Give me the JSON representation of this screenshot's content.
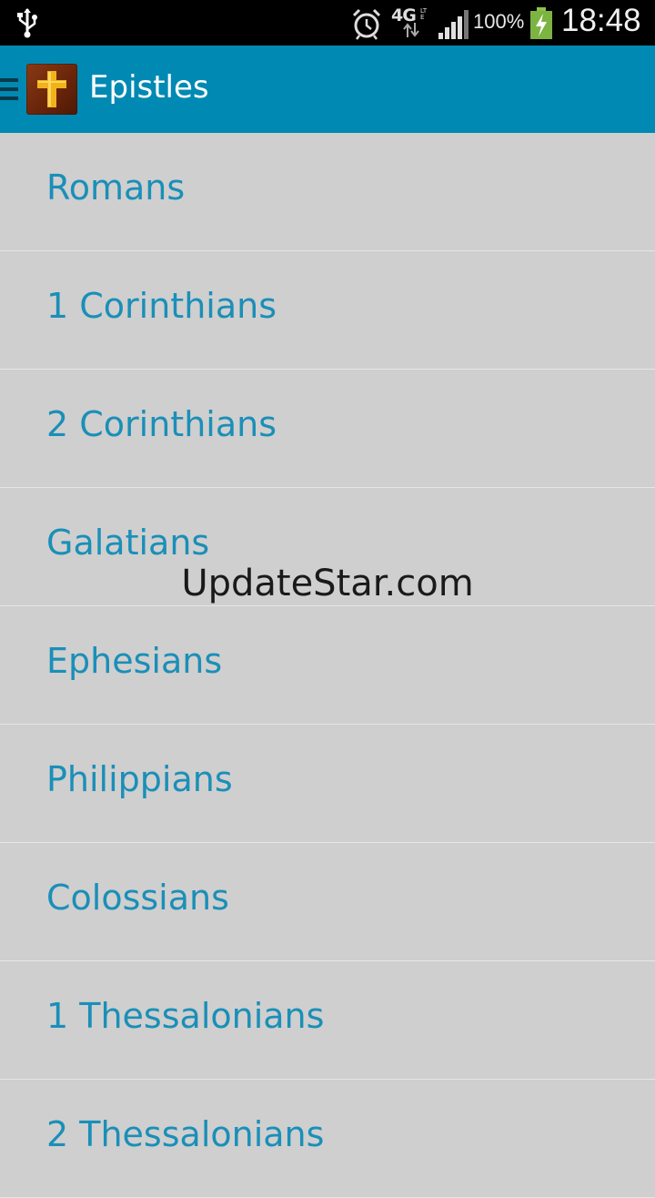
{
  "status_bar": {
    "network_label": "4G",
    "network_sub": "LTE",
    "battery_percent": "100%",
    "time": "18:48",
    "icons": [
      "usb-icon",
      "alarm-icon",
      "network-4g-lte-icon",
      "signal-icon",
      "battery-charging-icon"
    ]
  },
  "action_bar": {
    "title": "Epistles",
    "icons": [
      "drawer-menu-icon",
      "cross-app-icon"
    ],
    "background": "#0089b3"
  },
  "books": [
    {
      "label": "Romans"
    },
    {
      "label": "1 Corinthians"
    },
    {
      "label": "2 Corinthians"
    },
    {
      "label": "Galatians"
    },
    {
      "label": "Ephesians"
    },
    {
      "label": "Philippians"
    },
    {
      "label": "Colossians"
    },
    {
      "label": "1 Thessalonians"
    },
    {
      "label": "2 Thessalonians"
    }
  ],
  "watermark": "UpdateStar.com",
  "colors": {
    "list_background": "#cfcfcf",
    "list_text": "#1a8fb8",
    "divider": "#e6e6e6"
  }
}
